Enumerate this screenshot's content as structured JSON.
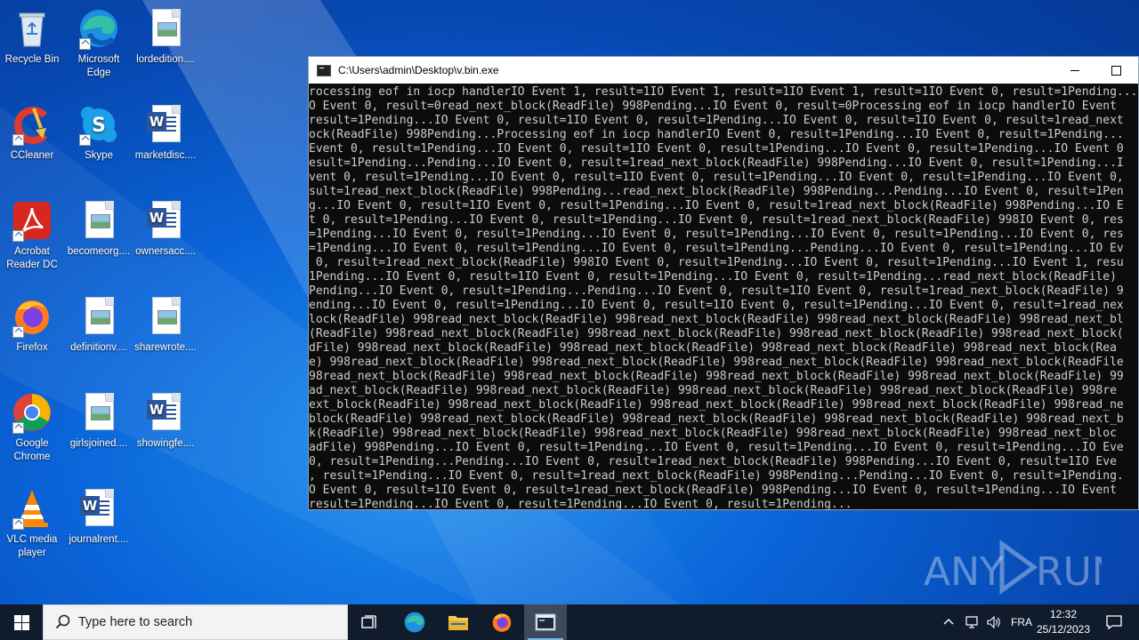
{
  "desktop": {
    "icons": [
      {
        "label": "Recycle Bin",
        "icon": "recycle-bin-icon"
      },
      {
        "label": "Microsoft Edge",
        "icon": "edge-icon"
      },
      {
        "label": "lordedition....",
        "icon": "image-file-icon"
      },
      {
        "label": "CCleaner",
        "icon": "ccleaner-icon"
      },
      {
        "label": "Skype",
        "icon": "skype-icon"
      },
      {
        "label": "marketdisc....",
        "icon": "word-file-icon"
      },
      {
        "label": "Acrobat Reader DC",
        "icon": "acrobat-icon"
      },
      {
        "label": "becomeorg....",
        "icon": "image-file-icon"
      },
      {
        "label": "ownersacc....",
        "icon": "word-file-icon"
      },
      {
        "label": "Firefox",
        "icon": "firefox-icon"
      },
      {
        "label": "definitionv....",
        "icon": "image-file-icon"
      },
      {
        "label": "sharewrote....",
        "icon": "image-file-icon"
      },
      {
        "label": "Google Chrome",
        "icon": "chrome-icon"
      },
      {
        "label": "girlsjoined....",
        "icon": "image-file-icon"
      },
      {
        "label": "showingfe....",
        "icon": "word-file-icon"
      },
      {
        "label": "VLC media player",
        "icon": "vlc-icon"
      },
      {
        "label": "journalrent....",
        "icon": "word-file-icon"
      }
    ]
  },
  "console_window": {
    "title": "C:\\Users\\admin\\Desktop\\v.bin.exe",
    "lines": [
      "rocessing eof in iocp handlerIO Event 1, result=1IO Event 1, result=1IO Event 1, result=1IO Event 0, result=1Pending...",
      "O Event 0, result=0read_next_block(ReadFile) 998Pending...IO Event 0, result=0Processing eof in iocp handlerIO Event",
      "result=1Pending...IO Event 0, result=1IO Event 0, result=1Pending...IO Event 0, result=1IO Event 0, result=1read_next",
      "ock(ReadFile) 998Pending...Processing eof in iocp handlerIO Event 0, result=1Pending...IO Event 0, result=1Pending...",
      "Event 0, result=1Pending...IO Event 0, result=1IO Event 0, result=1Pending...IO Event 0, result=1Pending...IO Event 0",
      "esult=1Pending...Pending...IO Event 0, result=1read_next_block(ReadFile) 998Pending...IO Event 0, result=1Pending...I",
      "vent 0, result=1Pending...IO Event 0, result=1IO Event 0, result=1Pending...IO Event 0, result=1Pending...IO Event 0,",
      "sult=1read_next_block(ReadFile) 998Pending...read_next_block(ReadFile) 998Pending...Pending...IO Event 0, result=1Pen",
      "g...IO Event 0, result=1IO Event 0, result=1Pending...IO Event 0, result=1read_next_block(ReadFile) 998Pending...IO E",
      "t 0, result=1Pending...IO Event 0, result=1Pending...IO Event 0, result=1read_next_block(ReadFile) 998IO Event 0, res",
      "=1Pending...IO Event 0, result=1Pending...IO Event 0, result=1Pending...IO Event 0, result=1Pending...IO Event 0, res",
      "=1Pending...IO Event 0, result=1Pending...IO Event 0, result=1Pending...Pending...IO Event 0, result=1Pending...IO Ev",
      " 0, result=1read_next_block(ReadFile) 998IO Event 0, result=1Pending...IO Event 0, result=1Pending...IO Event 1, resu",
      "1Pending...IO Event 0, result=1IO Event 0, result=1Pending...IO Event 0, result=1Pending...read_next_block(ReadFile)",
      "Pending...IO Event 0, result=1Pending...Pending...IO Event 0, result=1IO Event 0, result=1read_next_block(ReadFile) 9",
      "ending...IO Event 0, result=1Pending...IO Event 0, result=1IO Event 0, result=1Pending...IO Event 0, result=1read_nex",
      "lock(ReadFile) 998read_next_block(ReadFile) 998read_next_block(ReadFile) 998read_next_block(ReadFile) 998read_next_bl",
      "(ReadFile) 998read_next_block(ReadFile) 998read_next_block(ReadFile) 998read_next_block(ReadFile) 998read_next_block(",
      "dFile) 998read_next_block(ReadFile) 998read_next_block(ReadFile) 998read_next_block(ReadFile) 998read_next_block(Rea",
      "e) 998read_next_block(ReadFile) 998read_next_block(ReadFile) 998read_next_block(ReadFile) 998read_next_block(ReadFile",
      "98read_next_block(ReadFile) 998read_next_block(ReadFile) 998read_next_block(ReadFile) 998read_next_block(ReadFile) 99",
      "ad_next_block(ReadFile) 998read_next_block(ReadFile) 998read_next_block(ReadFile) 998read_next_block(ReadFile) 998re",
      "ext_block(ReadFile) 998read_next_block(ReadFile) 998read_next_block(ReadFile) 998read_next_block(ReadFile) 998read_ne",
      "block(ReadFile) 998read_next_block(ReadFile) 998read_next_block(ReadFile) 998read_next_block(ReadFile) 998read_next_b",
      "k(ReadFile) 998read_next_block(ReadFile) 998read_next_block(ReadFile) 998read_next_block(ReadFile) 998read_next_bloc",
      "adFile) 998Pending...IO Event 0, result=1Pending...IO Event 0, result=1Pending...IO Event 0, result=1Pending...IO Eve",
      "0, result=1Pending...Pending...IO Event 0, result=1read_next_block(ReadFile) 998Pending...IO Event 0, result=1IO Eve",
      ", result=1Pending...IO Event 0, result=1read_next_block(ReadFile) 998Pending...Pending...IO Event 0, result=1Pending.",
      "O Event 0, result=1IO Event 0, result=1read_next_block(ReadFile) 998Pending...IO Event 0, result=1Pending...IO Event",
      "result=1Pending...IO Event 0, result=1Pending...IO Event 0, result=1Pending..."
    ]
  },
  "watermark": {
    "text": "ANY RUN"
  },
  "taskbar": {
    "search_placeholder": "Type here to search",
    "language": "FRA",
    "time": "12:32",
    "date": "25/12/2023"
  }
}
